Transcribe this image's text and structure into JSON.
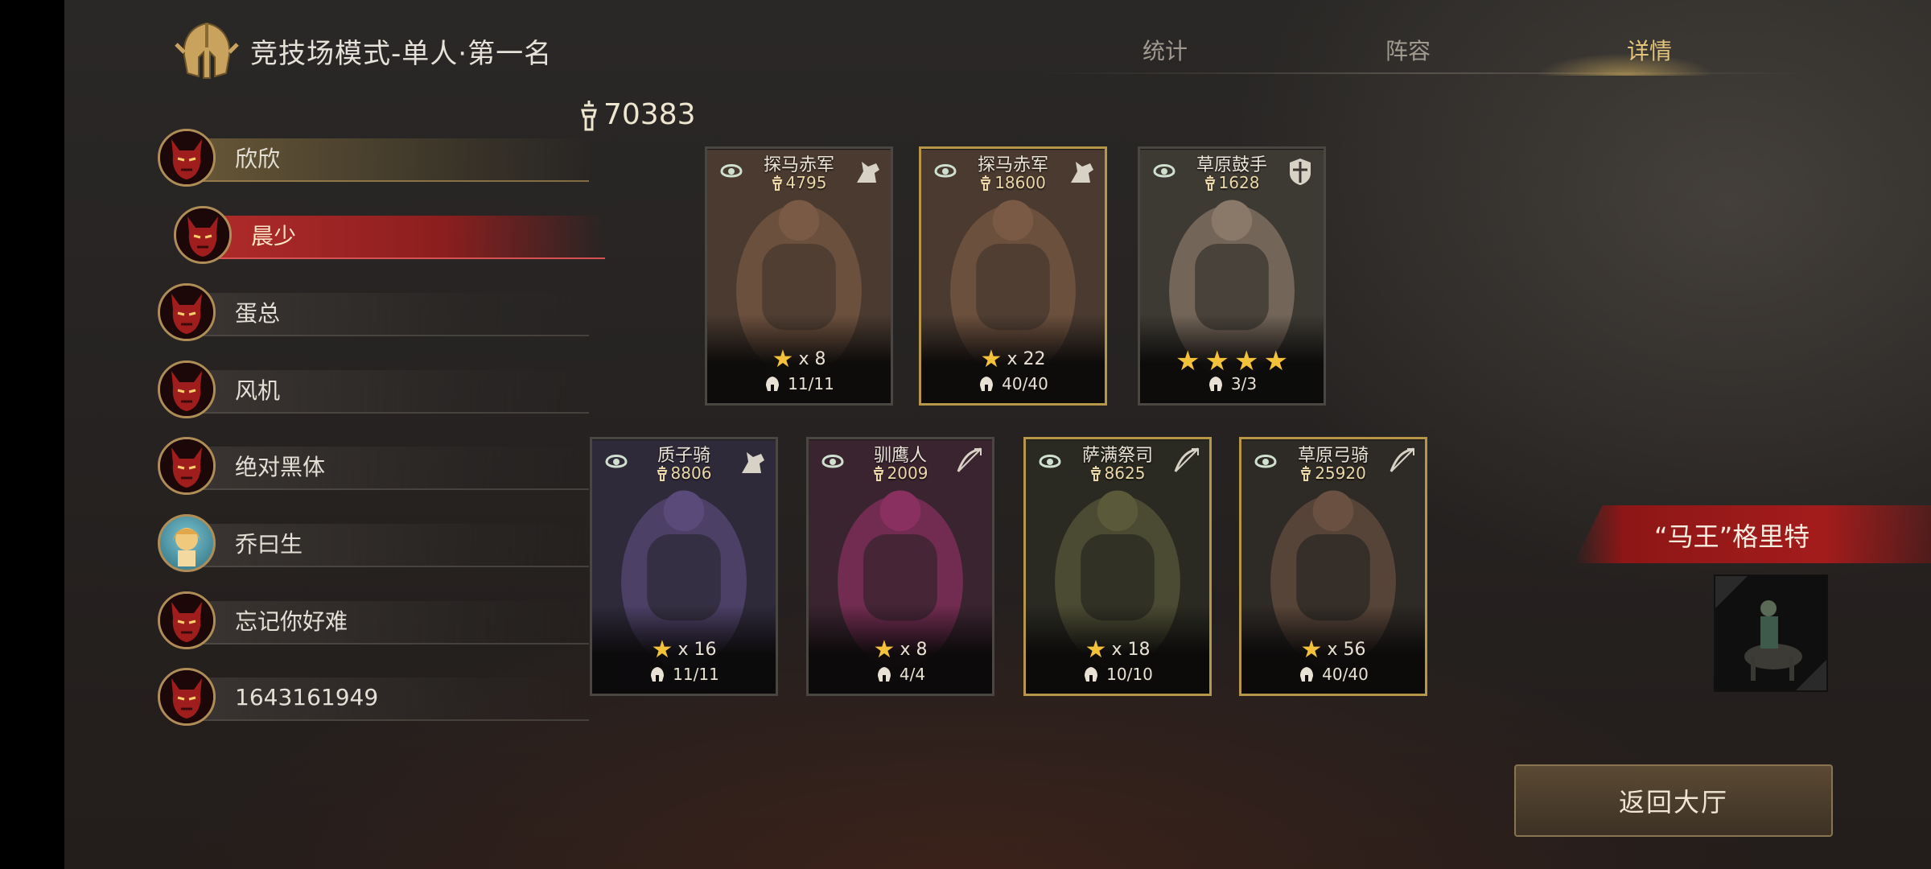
{
  "header": {
    "title": "竞技场模式-单人·第一名",
    "tabs": [
      {
        "label": "统计",
        "active": false
      },
      {
        "label": "阵容",
        "active": false
      },
      {
        "label": "详情",
        "active": true
      }
    ]
  },
  "players": [
    {
      "name": "欣欣",
      "state": "self",
      "avatar": "red-demon-avatar"
    },
    {
      "name": "晨少",
      "state": "selected",
      "avatar": "red-demon-avatar"
    },
    {
      "name": "蛋总",
      "state": "normal",
      "avatar": "red-demon-avatar"
    },
    {
      "name": "风机",
      "state": "normal",
      "avatar": "red-demon-avatar"
    },
    {
      "name": "绝对黑体",
      "state": "normal",
      "avatar": "red-demon-avatar"
    },
    {
      "name": "乔曰生",
      "state": "normal",
      "avatar": "blonde-girl-avatar"
    },
    {
      "name": "忘记你好难",
      "state": "normal",
      "avatar": "red-demon-avatar"
    },
    {
      "name": "1643161949",
      "state": "normal",
      "avatar": "red-demon-avatar"
    }
  ],
  "total_power": "70383",
  "cards": [
    {
      "name": "探马赤军",
      "power": "4795",
      "stars": "x 8",
      "troops": "11/11",
      "type_icon": "horse-icon",
      "gold": false
    },
    {
      "name": "探马赤军",
      "power": "18600",
      "stars": "x 22",
      "troops": "40/40",
      "type_icon": "horse-icon",
      "gold": true
    },
    {
      "name": "草原鼓手",
      "power": "1628",
      "star_count": 4,
      "troops": "3/3",
      "type_icon": "shield-icon",
      "gold": false
    },
    {
      "name": "质子骑",
      "power": "8806",
      "stars": "x 16",
      "troops": "11/11",
      "type_icon": "horse-icon",
      "gold": false
    },
    {
      "name": "驯鹰人",
      "power": "2009",
      "stars": "x 8",
      "troops": "4/4",
      "type_icon": "bow-icon",
      "gold": false
    },
    {
      "name": "萨满祭司",
      "power": "8625",
      "stars": "x 18",
      "troops": "10/10",
      "type_icon": "bow-icon",
      "gold": true
    },
    {
      "name": "草原弓骑",
      "power": "25920",
      "stars": "x 56",
      "troops": "40/40",
      "type_icon": "bow-icon",
      "gold": true
    }
  ],
  "hero": {
    "name": "“马王”格里特"
  },
  "return_button": "返回大厅",
  "colors": {
    "accent_gold": "#e4c47c",
    "selected_red": "#b12b2b",
    "star": "#f3c13a"
  }
}
